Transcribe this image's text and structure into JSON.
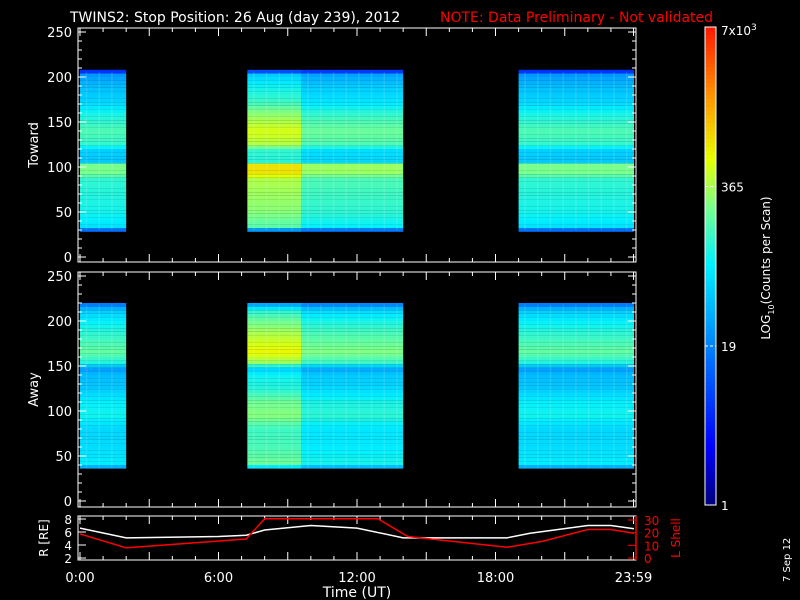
{
  "header": {
    "title": "TWINS2: Stop Position: 26 Aug (day 239), 2012",
    "note": "NOTE: Data Preliminary - Not validated"
  },
  "footer": {
    "date_stamp": "7 Sep 12"
  },
  "colors": {
    "note": "#ff0000",
    "axes": "#ffffff",
    "lshell": "#ff0000",
    "radius": "#ffffff"
  },
  "chart_data": {
    "type": "heatmap",
    "x_unit": "hours UT",
    "xlim": [
      0,
      24
    ],
    "xlabel": "Time (UT)",
    "xtick_labels": [
      {
        "t": 0,
        "label": "0:00"
      },
      {
        "t": 6,
        "label": "6:00"
      },
      {
        "t": 12,
        "label": "12:00"
      },
      {
        "t": 18,
        "label": "18:00"
      },
      {
        "t": 23.98,
        "label": "23:59"
      }
    ],
    "colorbar": {
      "label": "LOG10(Counts per Scan)",
      "label_main": "LOG",
      "label_sub": "10",
      "label_rest": "(Counts per Scan)",
      "scale": "log",
      "range": [
        1,
        7000
      ],
      "ticks": [
        {
          "value": 7000,
          "label": "7x10",
          "sup": "3"
        },
        {
          "value": 365,
          "label": "365"
        },
        {
          "value": 19,
          "label": "19"
        },
        {
          "value": 1,
          "label": "1"
        }
      ]
    },
    "segments": [
      {
        "start": 0.0,
        "end": 2.0,
        "gain": 1.0
      },
      {
        "start": 7.25,
        "end": 9.6,
        "gain": 1.22
      },
      {
        "start": 9.6,
        "end": 14.0,
        "gain": 1.05
      },
      {
        "start": 19.0,
        "end": 24.0,
        "gain": 1.0
      }
    ],
    "panels": [
      {
        "name": "Toward",
        "ylim": [
          0,
          250
        ],
        "yticks": [
          0,
          50,
          100,
          150,
          200,
          250
        ],
        "profile": [
          [
            30,
            0.3
          ],
          [
            34,
            0.48
          ],
          [
            50,
            0.52
          ],
          [
            88,
            0.55
          ],
          [
            92,
            0.62
          ],
          [
            102,
            0.62
          ],
          [
            106,
            0.44
          ],
          [
            118,
            0.45
          ],
          [
            125,
            0.55
          ],
          [
            140,
            0.58
          ],
          [
            160,
            0.52
          ],
          [
            172,
            0.46
          ],
          [
            190,
            0.42
          ],
          [
            203,
            0.36
          ],
          [
            206,
            0.2
          ]
        ]
      },
      {
        "name": "Away",
        "ylim": [
          0,
          250
        ],
        "yticks": [
          0,
          50,
          100,
          150,
          200,
          250
        ],
        "profile": [
          [
            36,
            0.3
          ],
          [
            40,
            0.5
          ],
          [
            60,
            0.47
          ],
          [
            80,
            0.46
          ],
          [
            95,
            0.52
          ],
          [
            110,
            0.5
          ],
          [
            125,
            0.44
          ],
          [
            140,
            0.42
          ],
          [
            148,
            0.36
          ],
          [
            152,
            0.52
          ],
          [
            165,
            0.6
          ],
          [
            185,
            0.55
          ],
          [
            200,
            0.5
          ],
          [
            212,
            0.44
          ],
          [
            218,
            0.32
          ]
        ]
      }
    ],
    "orbit": {
      "radius": {
        "name": "R [RE]",
        "ylim": [
          2,
          8
        ],
        "yticks": [
          2,
          4,
          6,
          8
        ],
        "points": [
          [
            0,
            6.6
          ],
          [
            2,
            5.1
          ],
          [
            6,
            5.3
          ],
          [
            7.2,
            5.5
          ],
          [
            8,
            6.3
          ],
          [
            10,
            7.0
          ],
          [
            12,
            6.6
          ],
          [
            14,
            5.1
          ],
          [
            18.5,
            5.1
          ],
          [
            19.5,
            5.8
          ],
          [
            22,
            7.0
          ],
          [
            23,
            7.0
          ],
          [
            24,
            6.5
          ]
        ]
      },
      "lshell": {
        "name": "L Shell",
        "ylim": [
          0,
          30
        ],
        "yticks": [
          0,
          10,
          20,
          30
        ],
        "points": [
          [
            0,
            19
          ],
          [
            2,
            8
          ],
          [
            7.2,
            15
          ],
          [
            8,
            31
          ],
          [
            12.9,
            31
          ],
          [
            14.2,
            17
          ],
          [
            18.5,
            8.5
          ],
          [
            20,
            13
          ],
          [
            22,
            22.5
          ],
          [
            23,
            22.5
          ],
          [
            24,
            19.5
          ]
        ]
      }
    }
  }
}
